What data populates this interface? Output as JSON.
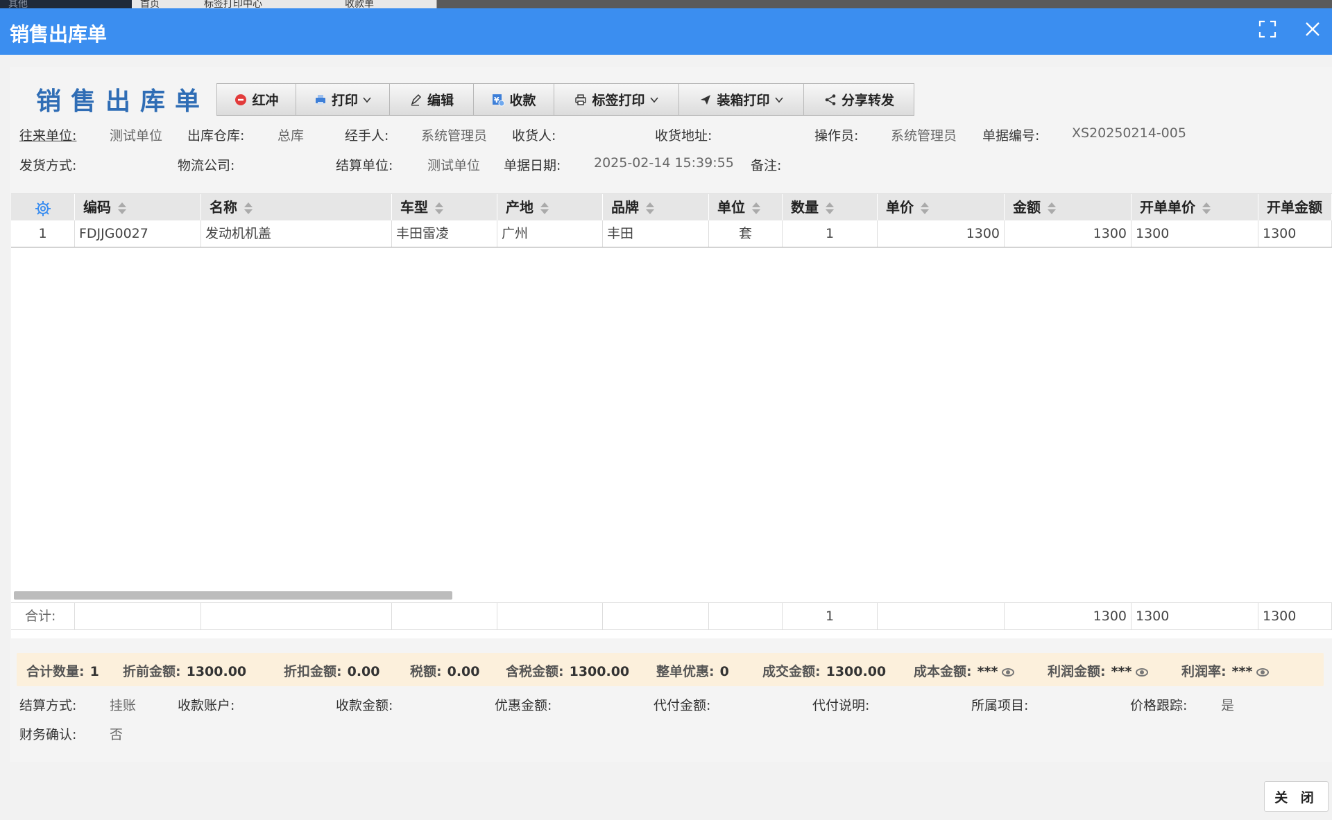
{
  "background_tabs": {
    "tab1": "其他",
    "tab2": "首页",
    "tab3": "标签打印中心",
    "tab4": "收款单"
  },
  "dialog": {
    "title": "销售出库单",
    "close_label": "关 闭"
  },
  "form": {
    "title": "销售出库单",
    "toolbar": {
      "red_reverse": "红冲",
      "print": "打印",
      "edit": "编辑",
      "receive": "收款",
      "label_print": "标签打印",
      "box_print": "装箱打印",
      "share": "分享转发"
    },
    "fields": {
      "partner_label": "往来单位:",
      "partner_value": "测试单位",
      "warehouse_label": "出库仓库:",
      "warehouse_value": "总库",
      "handler_label": "经手人:",
      "handler_value": "系统管理员",
      "receiver_label": "收货人:",
      "receiver_value": "",
      "address_label": "收货地址:",
      "address_value": "",
      "operator_label": "操作员:",
      "operator_value": "系统管理员",
      "docno_label": "单据编号:",
      "docno_value": "XS20250214-005",
      "ship_method_label": "发货方式:",
      "ship_method_value": "",
      "logistics_label": "物流公司:",
      "logistics_value": "",
      "settle_unit_label": "结算单位:",
      "settle_unit_value": "测试单位",
      "date_label": "单据日期:",
      "date_value": "2025-02-14 15:39:55",
      "remark_label": "备注:",
      "remark_value": ""
    }
  },
  "table": {
    "columns": [
      "编码",
      "名称",
      "车型",
      "产地",
      "品牌",
      "单位",
      "数量",
      "单价",
      "金额",
      "开单单价",
      "开单金额"
    ],
    "rows": [
      {
        "index": "1",
        "code": "FDJJG0027",
        "name": "发动机机盖",
        "model": "丰田雷凌",
        "origin": "广州",
        "brand": "丰田",
        "unit": "套",
        "qty": "1",
        "price": "1300",
        "amount": "1300",
        "bill_price": "1300",
        "bill_amount": "1300"
      }
    ],
    "summary": {
      "label": "合计:",
      "qty": "1",
      "amount": "1300",
      "bill_price": "1300",
      "bill_amount": "1300"
    }
  },
  "totals": {
    "qty_label": "合计数量:",
    "qty_value": "1",
    "pre_discount_label": "折前金额:",
    "pre_discount_value": "1300.00",
    "discount_label": "折扣金额:",
    "discount_value": "0.00",
    "tax_label": "税额:",
    "tax_value": "0.00",
    "tax_incl_label": "含税金额:",
    "tax_incl_value": "1300.00",
    "order_discount_label": "整单优惠:",
    "order_discount_value": "0",
    "deal_label": "成交金额:",
    "deal_value": "1300.00",
    "cost_label": "成本金额:",
    "cost_value": "***",
    "profit_label": "利润金额:",
    "profit_value": "***",
    "profit_rate_label": "利润率:",
    "profit_rate_value": "***"
  },
  "settlement": {
    "method_label": "结算方式:",
    "method_value": "挂账",
    "account_label": "收款账户:",
    "account_value": "",
    "received_label": "收款金额:",
    "received_value": "",
    "discount_amt_label": "优惠金额:",
    "discount_amt_value": "",
    "agent_pay_label": "代付金额:",
    "agent_pay_value": "",
    "agent_note_label": "代付说明:",
    "agent_note_value": "",
    "project_label": "所属项目:",
    "project_value": "",
    "price_track_label": "价格跟踪:",
    "price_track_value": "是",
    "finance_label": "财务确认:",
    "finance_value": "否"
  },
  "colors": {
    "titlebar": "#3b8ef0",
    "form_title": "#2f6db5",
    "totals_bg": "#fcf0dc"
  }
}
